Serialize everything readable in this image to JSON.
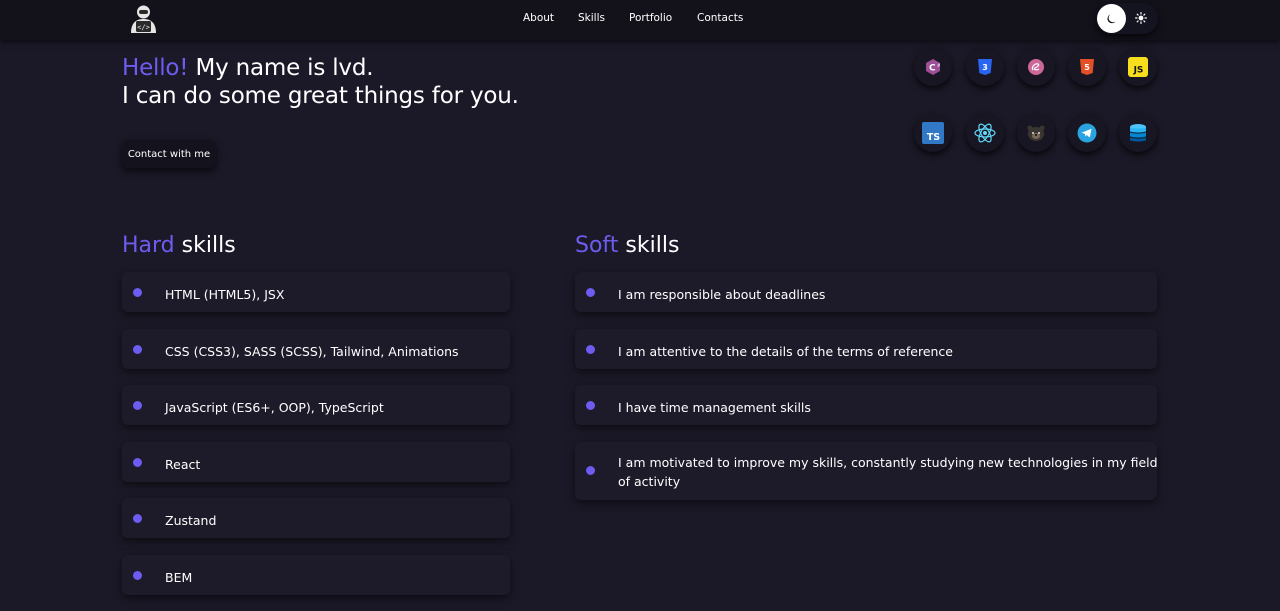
{
  "header": {
    "logo_icon": "coder-avatar-icon",
    "nav": [
      "About",
      "Skills",
      "Portfolio",
      "Contacts"
    ],
    "theme_toggle": {
      "dark_icon": "moon-icon",
      "light_icon": "sun-icon",
      "active": "dark"
    }
  },
  "hero": {
    "greeting": "Hello!",
    "name_line": " My name is lvd.",
    "tagline": "I can do some great things for you.",
    "contact_button": "Contact with me"
  },
  "tech_icons": [
    {
      "name": "csharp-icon",
      "color": "#9b4f96"
    },
    {
      "name": "css3-icon",
      "color": "#2965f1"
    },
    {
      "name": "sass-icon",
      "color": "#cd6799"
    },
    {
      "name": "html5-icon",
      "color": "#e34f26"
    },
    {
      "name": "javascript-icon",
      "color": "#f7df1e"
    },
    {
      "name": "typescript-icon",
      "color": "#3178c6"
    },
    {
      "name": "react-icon",
      "color": "#61dafb"
    },
    {
      "name": "zustand-icon",
      "color": "#8a8a8a"
    },
    {
      "name": "telegram-icon",
      "color": "#2aa3e0"
    },
    {
      "name": "database-icon",
      "color": "#29b6f6"
    }
  ],
  "hard_skills": {
    "title_accent": "Hard",
    "title_rest": " skills",
    "items": [
      "HTML (HTML5), JSX",
      "CSS (CSS3), SASS (SCSS), Tailwind, Animations",
      "JavaScript (ES6+, OOP), TypeScript",
      "React",
      "Zustand",
      "BEM"
    ]
  },
  "soft_skills": {
    "title_accent": "Soft",
    "title_rest": " skills",
    "items": [
      "I am responsible about deadlines",
      "I am attentive to the details of the terms of reference",
      "I have time management skills",
      "I am motivated to improve my skills, constantly studying new technologies in my field of activity"
    ]
  },
  "colors": {
    "background": "#1b1927",
    "header": "#13121b",
    "accent": "#6d5cf0",
    "card": "#1d1b29"
  }
}
